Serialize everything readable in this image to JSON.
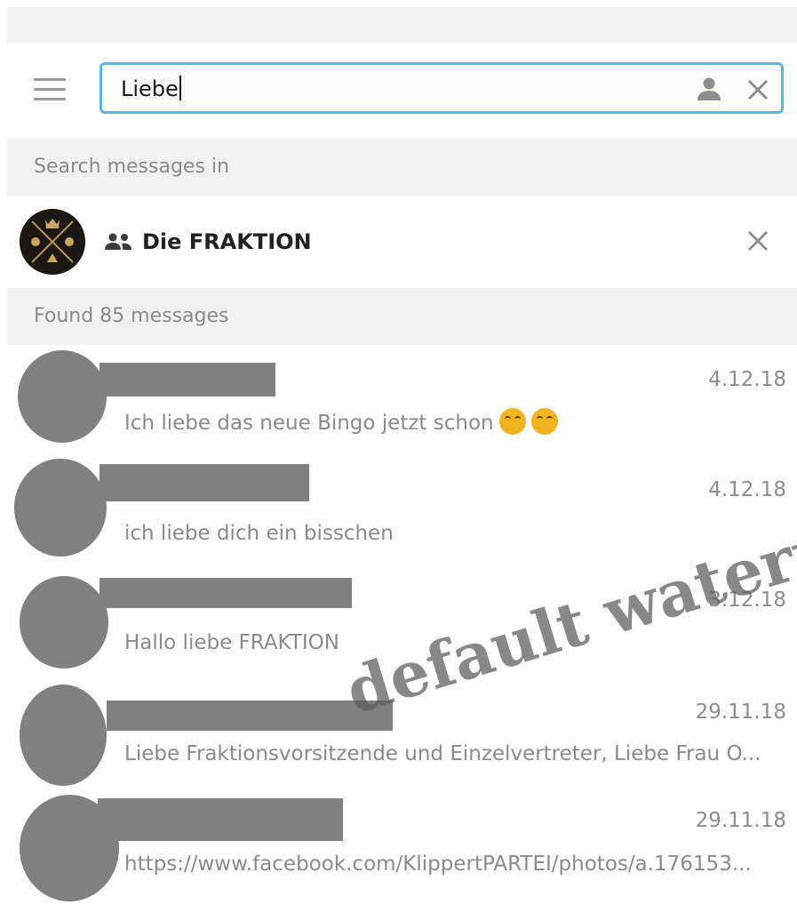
{
  "search": {
    "query": "Liebe"
  },
  "filter": {
    "heading": "Search messages in",
    "chat_name": "Die FRAKTION"
  },
  "results_header": "Found 85 messages",
  "results": [
    {
      "date": "4.12.18",
      "text": "Ich liebe das neue Bingo jetzt schon",
      "emoji_count": 2
    },
    {
      "date": "4.12.18",
      "text": "ich liebe dich ein bisschen"
    },
    {
      "date": "3.12.18",
      "text": "Hallo liebe FRAKTION"
    },
    {
      "date": "29.11.18",
      "text": "Liebe Fraktionsvorsitzende und Einzelvertreter, Liebe Frau O..."
    },
    {
      "date": "29.11.18",
      "text": "https://www.facebook.com/KlippertPARTEI/photos/a.176153..."
    }
  ],
  "watermark": "default waterm",
  "colors": {
    "accent": "#5fb6d6",
    "section_bg": "#f1f1f1",
    "redaction": "#808080",
    "muted_text": "#8a8a8a"
  },
  "icons": [
    "hamburger-menu-icon",
    "person-icon",
    "close-icon",
    "group-icon",
    "close-icon"
  ]
}
